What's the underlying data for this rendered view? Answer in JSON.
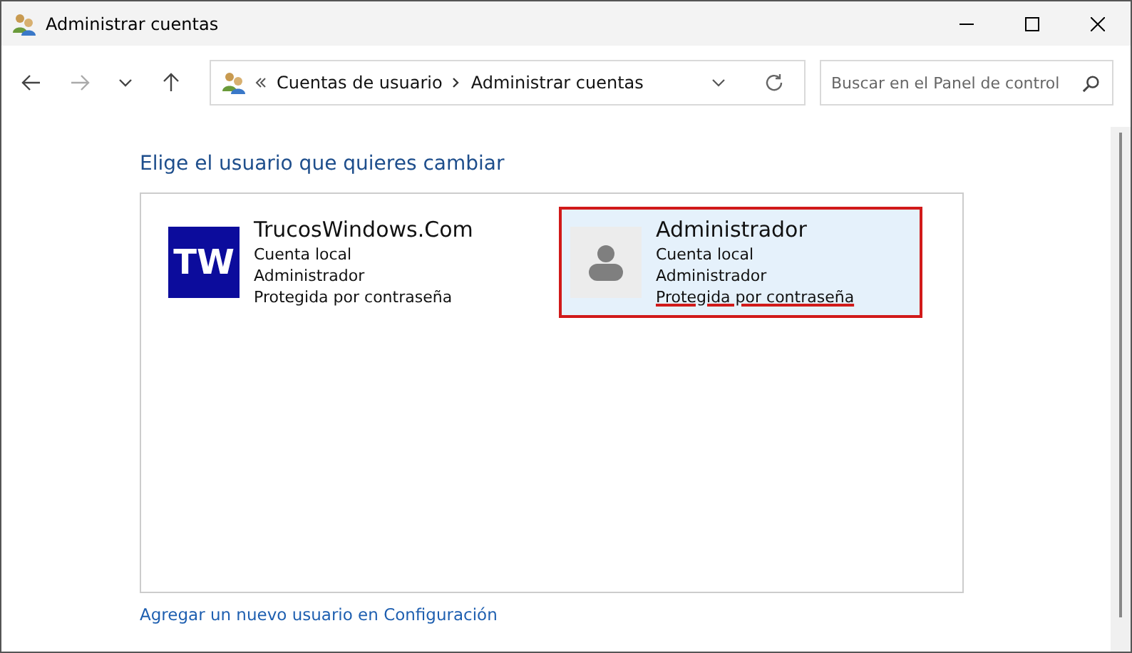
{
  "window": {
    "title": "Administrar cuentas"
  },
  "address": {
    "breadcrumbs": [
      "Cuentas de usuario",
      "Administrar cuentas"
    ]
  },
  "search": {
    "placeholder": "Buscar en el Panel de control"
  },
  "heading": "Elige el usuario que quieres cambiar",
  "users": [
    {
      "kind": "initials",
      "initials": "TW",
      "name": "TrucosWindows.Com",
      "details": [
        "Cuenta local",
        "Administrador",
        "Protegida por contraseña"
      ],
      "selected": false,
      "annotated": false
    },
    {
      "kind": "silhouette",
      "name": "Administrador",
      "details": [
        "Cuenta local",
        "Administrador",
        "Protegida por contraseña"
      ],
      "selected": true,
      "annotated": true
    }
  ],
  "link": "Agregar un nuevo usuario en Configuración"
}
